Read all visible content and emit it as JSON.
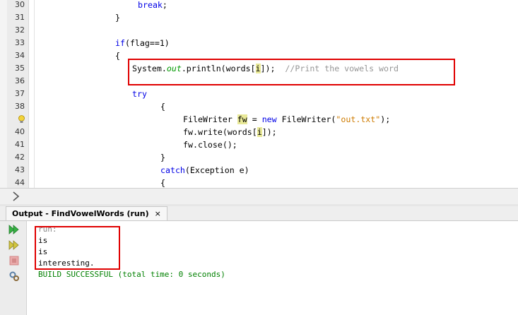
{
  "editor": {
    "lines": [
      {
        "n": "30",
        "tokens": [
          {
            "t": "break",
            "c": "kw"
          },
          {
            "t": ";"
          }
        ]
      },
      {
        "n": "31",
        "tokens": [
          {
            "t": "}"
          }
        ]
      },
      {
        "n": "32",
        "tokens": []
      },
      {
        "n": "33",
        "tokens": [
          {
            "t": "if",
            "c": "kw"
          },
          {
            "t": "(flag==1)"
          }
        ]
      },
      {
        "n": "34",
        "tokens": [
          {
            "t": "{"
          }
        ]
      },
      {
        "n": "35",
        "tokens": [
          {
            "t": "System."
          },
          {
            "t": "out",
            "c": "fld"
          },
          {
            "t": ".println(words["
          },
          {
            "t": "i",
            "c": "hl"
          },
          {
            "t": "]);  "
          },
          {
            "t": "//Print the vowels word",
            "c": "cmt"
          }
        ]
      },
      {
        "n": "36",
        "tokens": []
      },
      {
        "n": "37",
        "tokens": [
          {
            "t": "try",
            "c": "kw"
          }
        ]
      },
      {
        "n": "38",
        "tokens": [
          {
            "t": "{"
          }
        ]
      },
      {
        "n": "",
        "tokens": [
          {
            "t": "FileWriter "
          },
          {
            "t": "fw",
            "c": "hl"
          },
          {
            "t": " = "
          },
          {
            "t": "new",
            "c": "kw"
          },
          {
            "t": " FileWriter("
          },
          {
            "t": "\"out.txt\"",
            "c": "str"
          },
          {
            "t": ");"
          }
        ]
      },
      {
        "n": "40",
        "tokens": [
          {
            "t": "fw.write(words["
          },
          {
            "t": "i",
            "c": "hl"
          },
          {
            "t": "]);"
          }
        ]
      },
      {
        "n": "41",
        "tokens": [
          {
            "t": "fw.close();"
          }
        ]
      },
      {
        "n": "42",
        "tokens": [
          {
            "t": "}"
          }
        ]
      },
      {
        "n": "43",
        "tokens": [
          {
            "t": "catch",
            "c": "kw"
          },
          {
            "t": "(Exception e)"
          }
        ]
      },
      {
        "n": "44",
        "tokens": [
          {
            "t": "{"
          }
        ]
      }
    ]
  },
  "output": {
    "tab_label": "Output - FindVowelWords (run)",
    "close_glyph": "×",
    "lines": [
      {
        "text": "run:",
        "color": "#8a8a8a"
      },
      {
        "text": "is",
        "color": "#000000"
      },
      {
        "text": "is",
        "color": "#000000"
      },
      {
        "text": "interesting.",
        "color": "#000000"
      },
      {
        "text": "BUILD SUCCESSFUL (total time: 0 seconds)",
        "color": "#008000"
      }
    ]
  },
  "icons": {
    "rerun": "play-double-icon",
    "rerun_with_options": "play-double-options-icon",
    "stop": "stop-icon",
    "settings": "settings-icon",
    "hint": "lightbulb-warning-icon"
  }
}
